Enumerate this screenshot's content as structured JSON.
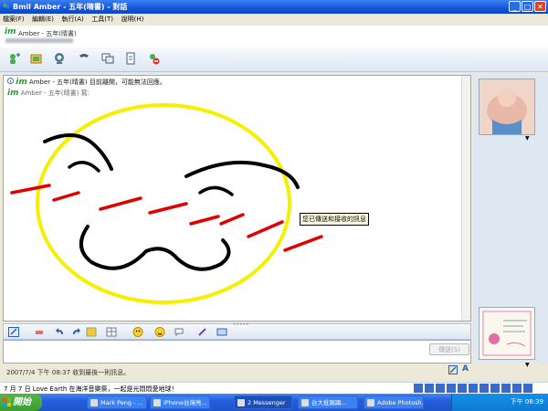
{
  "window": {
    "title": "Bmil Amber - 五年(晴書) - 對話"
  },
  "menu": [
    {
      "label": "檔案(F)"
    },
    {
      "label": "編輯(E)"
    },
    {
      "label": "執行(A)"
    },
    {
      "label": "工具(T)"
    },
    {
      "label": "說明(H)"
    }
  ],
  "header": {
    "logo": "im",
    "contact_name": "Amber - 五年(晴書)"
  },
  "chat": {
    "notice": "Amber - 五年(晴書) 目前離開，可能無法回應。",
    "sender_line": "Amber - 五年(晴書) 寫:",
    "tooltip": "您已傳送和接收的訊息"
  },
  "colors": {
    "face": "#f5f000",
    "cheeks": "#e00000",
    "ink": "#000000",
    "titlebar": "#1556d8"
  },
  "input": {
    "send_label": "傳送(S)"
  },
  "last_message": "2007/7/4 下午 08:37 收到最後一則訊息。",
  "status": {
    "text": "7 月 7 日 Love Earth 在海洋音樂祭，一起是光悶悶愛地球！"
  },
  "taskbar": {
    "start_label": "開始",
    "tasks": [
      {
        "label": "Mark Peng - ..."
      },
      {
        "label": "iPhone台灣亮..."
      },
      {
        "label": "2 Messenger"
      },
      {
        "label": "台大批踢踢..."
      },
      {
        "label": "Adobe Photosh..."
      }
    ],
    "clock": "下午 08:39"
  }
}
